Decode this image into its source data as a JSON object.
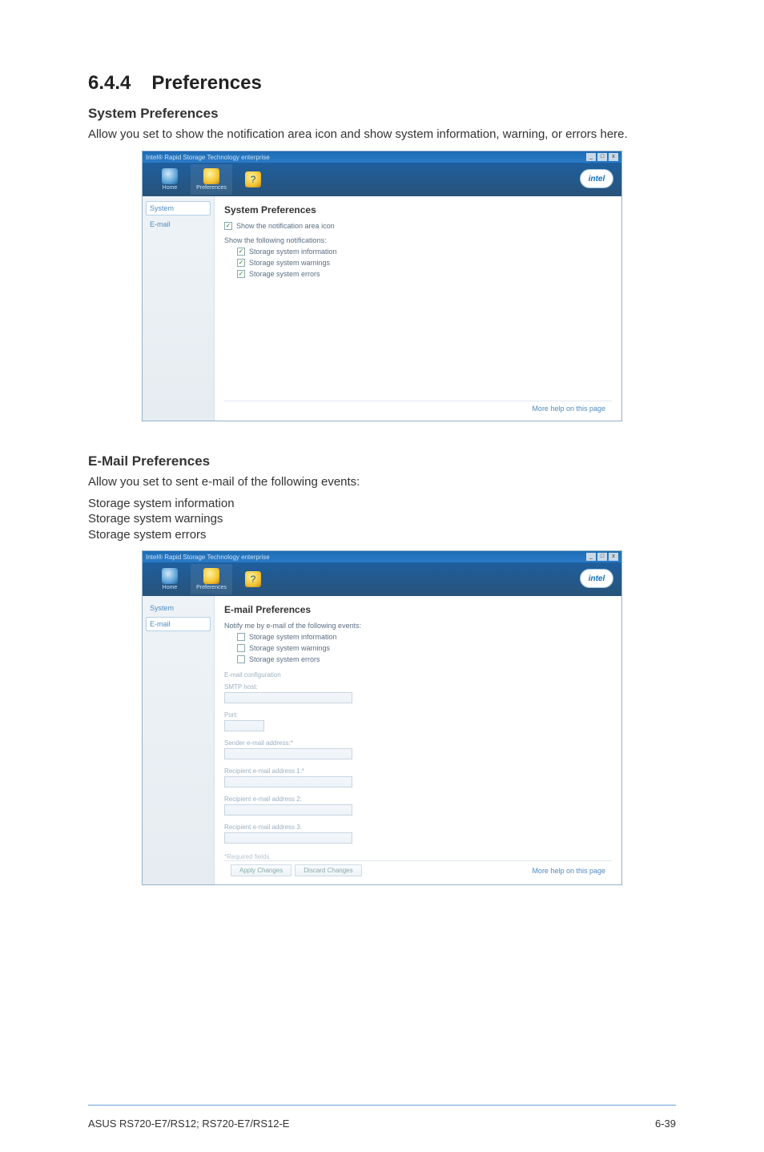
{
  "headings": {
    "section_number": "6.4.4",
    "section_title": "Preferences",
    "system_prefs": "System Preferences",
    "email_prefs": "E-Mail Preferences"
  },
  "body": {
    "system_prefs_desc": "Allow you set to show the notification area icon and show system information, warning, or errors here.",
    "email_prefs_desc": "Allow you set to sent e-mail of the following events:",
    "email_events": [
      "Storage system information",
      "Storage system warnings",
      "Storage system errors"
    ]
  },
  "window": {
    "title": "Intel® Rapid Storage Technology enterprise",
    "win_min": "_",
    "win_max": "□",
    "win_close": "x",
    "toolbar": {
      "home": "Home",
      "preferences": "Preferences",
      "help_icon": "?"
    },
    "intel_logo": "intel",
    "sidebar": {
      "system": "System",
      "email": "E-mail"
    },
    "help_link": "More help on this page"
  },
  "screenshot_system": {
    "title": "System Preferences",
    "show_icon": "Show the notification area icon",
    "show_following": "Show the following notifications:",
    "opt_info": "Storage system information",
    "opt_warn": "Storage system warnings",
    "opt_err": "Storage system errors"
  },
  "screenshot_email": {
    "title": "E-mail Preferences",
    "notify_line": "Notify me by e-mail of the following events:",
    "opt_info": "Storage system information",
    "opt_warn": "Storage system warnings",
    "opt_err": "Storage system errors",
    "field_config": "E-mail configuration",
    "field_smtp": "SMTP host:",
    "field_port": "Port:",
    "field_sender": "Sender e-mail address:*",
    "field_recipient1": "Recipient e-mail address 1:*",
    "field_recipient2": "Recipient e-mail address 2:",
    "field_recipient3": "Recipient e-mail address 3:",
    "required_note": "*Required fields",
    "btn_apply": "Apply Changes",
    "btn_discard": "Discard Changes"
  },
  "footer": {
    "product": "ASUS RS720-E7/RS12; RS720-E7/RS12-E",
    "page": "6-39"
  }
}
